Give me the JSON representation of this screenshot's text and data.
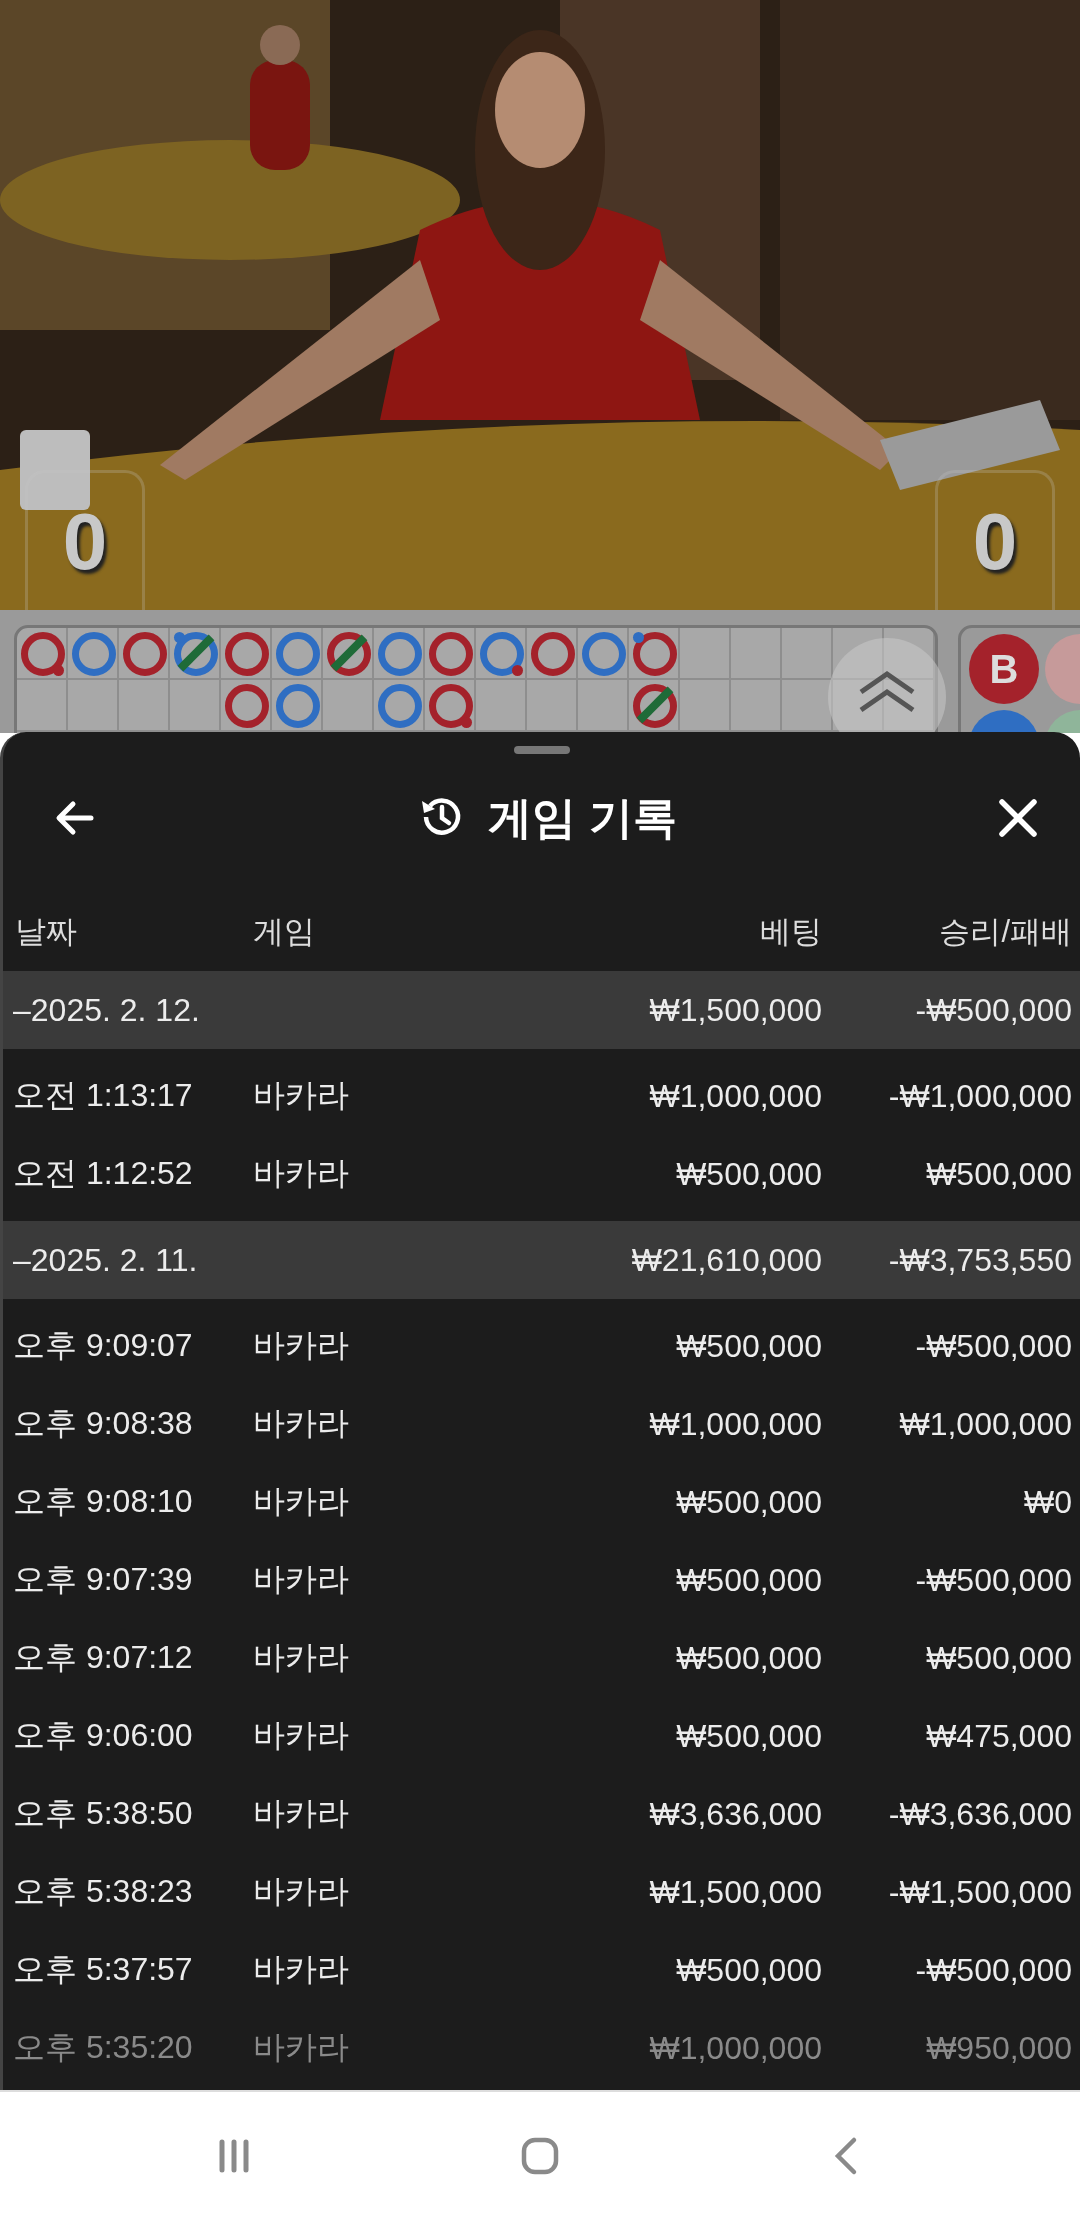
{
  "video": {
    "kind": "picture",
    "scores": [
      "0",
      "0"
    ]
  },
  "road": {
    "columns": [
      [
        {
          "color": "#a4222b",
          "tie": false,
          "player_pair": false,
          "banker_pair": true
        }
      ],
      [
        {
          "color": "#2f6ec2",
          "tie": false,
          "player_pair": false,
          "banker_pair": false
        }
      ],
      [
        {
          "color": "#a4222b",
          "tie": false,
          "player_pair": false,
          "banker_pair": false
        }
      ],
      [
        {
          "color": "#2f6ec2",
          "tie": true,
          "player_pair": true,
          "banker_pair": false
        }
      ],
      [
        {
          "color": "#a4222b",
          "tie": false,
          "player_pair": false,
          "banker_pair": false
        },
        {
          "color": "#a4222b",
          "tie": false,
          "player_pair": false,
          "banker_pair": false
        }
      ],
      [
        {
          "color": "#2f6ec2",
          "tie": false,
          "player_pair": false,
          "banker_pair": false
        },
        {
          "color": "#2f6ec2",
          "tie": false,
          "player_pair": false,
          "banker_pair": false
        }
      ],
      [
        {
          "color": "#a4222b",
          "tie": true,
          "player_pair": false,
          "banker_pair": false
        }
      ],
      [
        {
          "color": "#2f6ec2",
          "tie": false,
          "player_pair": false,
          "banker_pair": false
        },
        {
          "color": "#2f6ec2",
          "tie": false,
          "player_pair": false,
          "banker_pair": false
        }
      ],
      [
        {
          "color": "#a4222b",
          "tie": false,
          "player_pair": false,
          "banker_pair": false
        },
        {
          "color": "#a4222b",
          "tie": false,
          "player_pair": false,
          "banker_pair": true
        }
      ],
      [
        {
          "color": "#2f6ec2",
          "tie": false,
          "player_pair": false,
          "banker_pair": true
        }
      ],
      [
        {
          "color": "#a4222b",
          "tie": false,
          "player_pair": false,
          "banker_pair": false
        }
      ],
      [
        {
          "color": "#2f6ec2",
          "tie": false,
          "player_pair": false,
          "banker_pair": false
        }
      ],
      [
        {
          "color": "#a4222b",
          "tie": false,
          "player_pair": true,
          "banker_pair": false
        },
        {
          "color": "#a4222b",
          "tie": true,
          "player_pair": false,
          "banker_pair": false
        }
      ]
    ],
    "side_badge": "B"
  },
  "sheet": {
    "title": "게임 기록",
    "columns": [
      "날짜",
      "게임",
      "베팅",
      "승리/패배"
    ],
    "groups": [
      {
        "date": "–2025. 2. 12.",
        "bet": "₩1,500,000",
        "result": "-₩500,000",
        "rows": [
          {
            "time": "오전 1:13:17",
            "game": "바카라",
            "bet": "₩1,000,000",
            "result": "-₩1,000,000",
            "faded": false
          },
          {
            "time": "오전 1:12:52",
            "game": "바카라",
            "bet": "₩500,000",
            "result": "₩500,000",
            "faded": false
          }
        ]
      },
      {
        "date": "–2025. 2. 11.",
        "bet": "₩21,610,000",
        "result": "-₩3,753,550",
        "rows": [
          {
            "time": "오후 9:09:07",
            "game": "바카라",
            "bet": "₩500,000",
            "result": "-₩500,000",
            "faded": false
          },
          {
            "time": "오후 9:08:38",
            "game": "바카라",
            "bet": "₩1,000,000",
            "result": "₩1,000,000",
            "faded": false
          },
          {
            "time": "오후 9:08:10",
            "game": "바카라",
            "bet": "₩500,000",
            "result": "₩0",
            "faded": false
          },
          {
            "time": "오후 9:07:39",
            "game": "바카라",
            "bet": "₩500,000",
            "result": "-₩500,000",
            "faded": false
          },
          {
            "time": "오후 9:07:12",
            "game": "바카라",
            "bet": "₩500,000",
            "result": "₩500,000",
            "faded": false
          },
          {
            "time": "오후 9:06:00",
            "game": "바카라",
            "bet": "₩500,000",
            "result": "₩475,000",
            "faded": false
          },
          {
            "time": "오후 5:38:50",
            "game": "바카라",
            "bet": "₩3,636,000",
            "result": "-₩3,636,000",
            "faded": false
          },
          {
            "time": "오후 5:38:23",
            "game": "바카라",
            "bet": "₩1,500,000",
            "result": "-₩1,500,000",
            "faded": false
          },
          {
            "time": "오후 5:37:57",
            "game": "바카라",
            "bet": "₩500,000",
            "result": "-₩500,000",
            "faded": false
          },
          {
            "time": "오후 5:35:20",
            "game": "바카라",
            "bet": "₩1,000,000",
            "result": "₩950,000",
            "faded": true
          }
        ]
      }
    ]
  }
}
